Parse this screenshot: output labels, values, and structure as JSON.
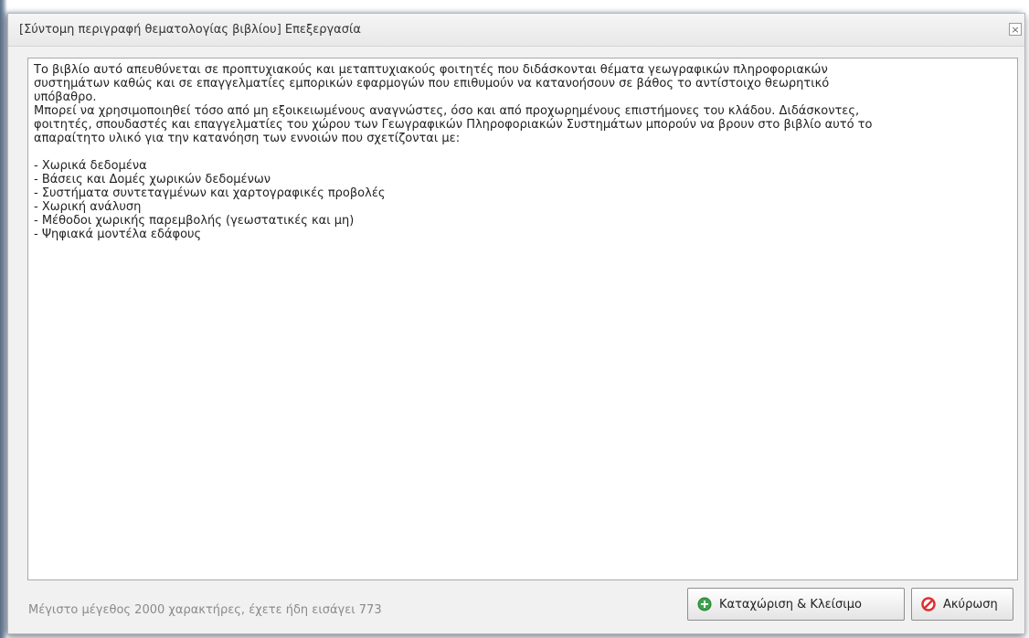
{
  "dialog": {
    "title": "[Σύντομη περιγραφή θεματολογίας βιβλίου] Επεξεργασία",
    "close_glyph": "×"
  },
  "editor": {
    "lines": [
      "Το βιβλίο αυτό απευθύνεται σε προπτυχιακούς και μεταπτυχιακούς φοιτητές που διδάσκονται θέματα γεωγραφικών πληροφοριακών",
      "συστημάτων καθώς και σε επαγγελματίες εμπορικών εφαρμογών που επιθυμούν να κατανοήσουν σε βάθος το αντίστοιχο θεωρητικό",
      "υπόβαθρο.",
      "Μπορεί να χρησιμοποιηθεί τόσο από μη εξοικειωμένους αναγνώστες, όσο και από προχωρημένους επιστήμονες του κλάδου. Διδάσκοντες,",
      "φοιτητές, σπουδαστές και επαγγελματίες του χώρου των Γεωγραφικών Πληροφοριακών Συστημάτων μπορούν να βρουν στο βιβλίο αυτό το",
      "απαραίτητο υλικό για την κατανόηση των εννοιών που σχετίζονται με:",
      "",
      "- Χωρικά δεδομένα",
      "- Βάσεις και Δομές χωρικών δεδομένων",
      "- Συστήματα συντεταγμένων και χαρτογραφικές προβολές",
      "- Χωρική ανάλυση",
      "- Μέθοδοι χωρικής παρεμβολής (γεωστατικές και μη)",
      "- Ψηφιακά μοντέλα εδάφους"
    ]
  },
  "footer": {
    "info": "Μέγιστο μέγεθος 2000 χαρακτήρες, έχετε ήδη εισάγει 773",
    "save_label": "Καταχώριση & Κλείσιμο",
    "cancel_label": "Ακύρωση",
    "save_icon": "plus-circle-icon",
    "cancel_icon": "cancel-circle-icon",
    "save_icon_color": "#3aa34a",
    "cancel_icon_color": "#e0302d"
  }
}
